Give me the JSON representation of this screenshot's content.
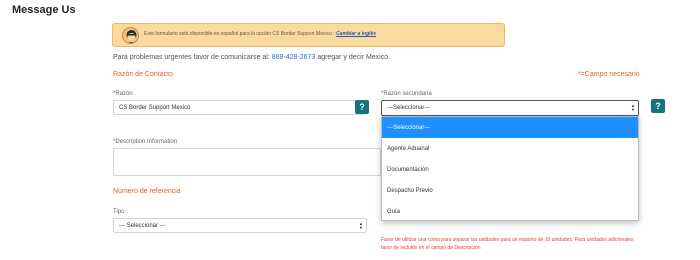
{
  "page": {
    "title": "Message Us"
  },
  "banner": {
    "text": "Este formulario está disponible en español para la opción CS Border Support Mexico :",
    "link": "Cambiar a inglés",
    "icon": "agent-avatar-icon"
  },
  "urgent": {
    "prefix": "Para problemas urgentes favor de comunicarse al:",
    "phone": "888-428-2673",
    "suffix": "agregar y decir Mexico."
  },
  "contact_section": {
    "title": "Razón de Contacto",
    "required_note": "*=Campo necesario"
  },
  "reason": {
    "label": "*Razón",
    "value": "CS Border Support Mexico",
    "help": "?"
  },
  "secondary_reason": {
    "label": "*Razón secundaria",
    "value": "---Seleccionar---",
    "help": "?",
    "options": [
      "---Seleccionar---",
      "Agente Aduanal",
      "Documentación",
      "Despacho Previo",
      "Guía"
    ],
    "selected_index": 0
  },
  "description": {
    "label": "*Description Information"
  },
  "reference_section": {
    "title": "Numero de referencia"
  },
  "tipo": {
    "label": "Tipo :",
    "value": "--- Seleccionar ---"
  },
  "reference_hint": "Favor de utilizar una coma para separar las unidades para un máximo de 10 unidades. Para unidades adicionales favor de incluirlo en el campo de Descripción",
  "colors": {
    "accent_orange": "#e5622a",
    "banner_bg": "#fbd9a0",
    "help_button": "#17727e",
    "dropdown_highlight": "#1e90ff",
    "error_red": "#e23b3b"
  }
}
